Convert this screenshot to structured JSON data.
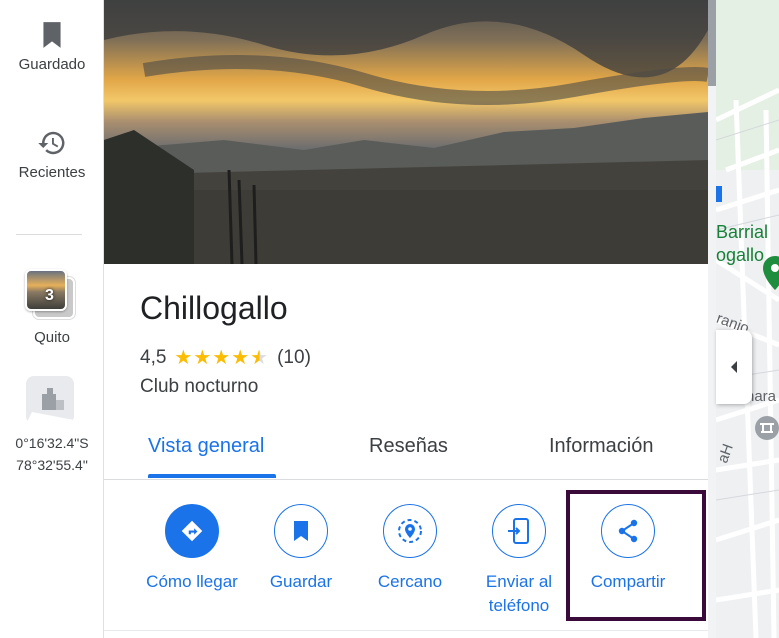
{
  "rail": {
    "saved_label": "Guardado",
    "recents_label": "Recientes",
    "quito_count": "3",
    "quito_label": "Quito",
    "coords_line1": "0°16'32.4\"S",
    "coords_line2": "78°32'55.4\""
  },
  "place": {
    "name": "Chillogallo",
    "rating": "4,5",
    "stars_value": 4.5,
    "stars_text": "★★★★★",
    "review_count": "(10)",
    "category": "Club nocturno"
  },
  "tabs": [
    {
      "label": "Vista general",
      "active": true
    },
    {
      "label": "Reseñas",
      "active": false
    },
    {
      "label": "Información",
      "active": false
    }
  ],
  "actions": [
    {
      "label": "Cómo llegar",
      "icon": "directions-icon"
    },
    {
      "label": "Guardar",
      "icon": "bookmark-icon"
    },
    {
      "label": "Cercano",
      "icon": "nearby-icon"
    },
    {
      "label": "Enviar al teléfono",
      "icon": "send-to-phone-icon"
    },
    {
      "label": "Compartir",
      "icon": "share-icon"
    }
  ],
  "map": {
    "label_1": "Barrial",
    "label_2": "ogallo",
    "label_3": "ranio",
    "label_4": "hara",
    "label_5": "aH"
  },
  "colors": {
    "accent": "#1a73e8",
    "star": "#fbbc04",
    "highlight_border": "#3a0a3a",
    "map_label_green": "#188038"
  }
}
